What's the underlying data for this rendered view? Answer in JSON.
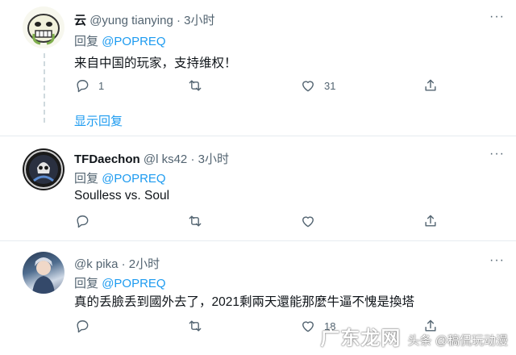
{
  "tweets": [
    {
      "name": "云",
      "handle": "@yung   tianying",
      "dot": "·",
      "time": "3小时",
      "reply_prefix": "回复",
      "reply_to": "@POPREQ",
      "text": "来自中国的玩家，支持维权！",
      "replies": "1",
      "retweets": "",
      "likes": "31",
      "show_replies": "显示回复"
    },
    {
      "name": "TFDaechon",
      "handle": "@l   ks42",
      "dot": "·",
      "time": "3小时",
      "reply_prefix": "回复",
      "reply_to": "@POPREQ",
      "text": "Soulless vs. Soul",
      "replies": "",
      "retweets": "",
      "likes": ""
    },
    {
      "name": "",
      "handle": "@k      pika",
      "dot": "·",
      "time": "2小时",
      "reply_prefix": "回复",
      "reply_to": "@POPREQ",
      "text": "真的丢臉丢到國外去了，2021剩兩天還能那麼牛逼不愧是換塔",
      "replies": "",
      "retweets": "",
      "likes": "18"
    }
  ],
  "more_label": "···",
  "watermark": {
    "brand": "广东龙网",
    "caption": "头条 @稿侃玩动漫"
  },
  "colors": {
    "link": "#1d9bf0",
    "muted": "#536471",
    "divider": "#e6ecf0"
  }
}
